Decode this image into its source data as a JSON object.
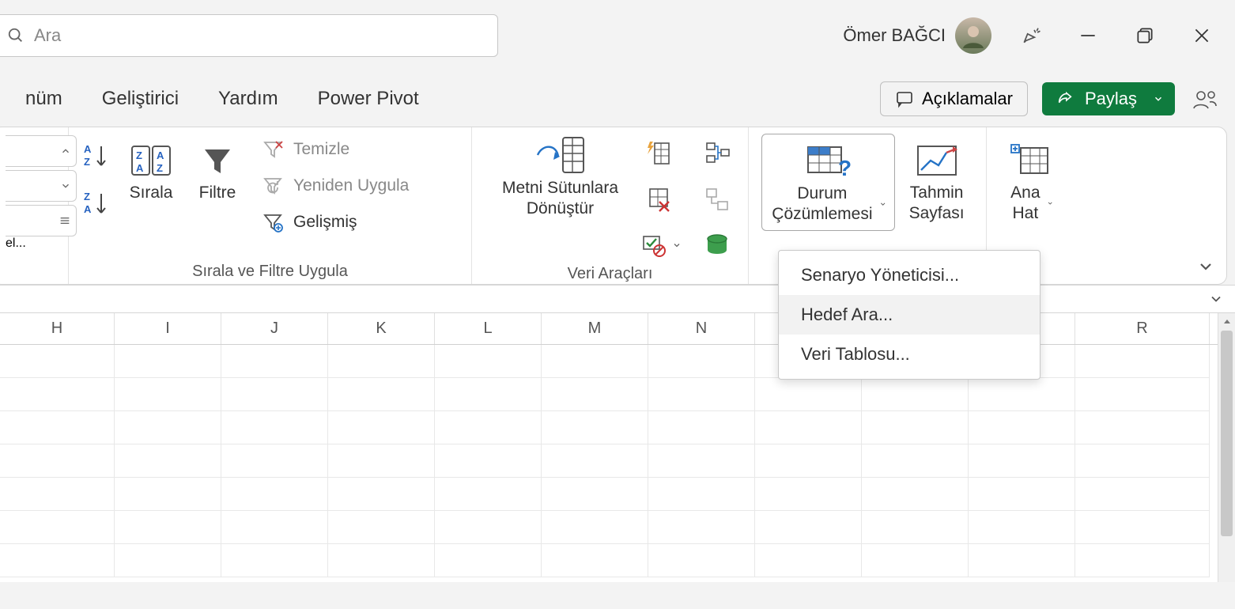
{
  "titlebar": {
    "search_placeholder": "Ara",
    "user_name": "Ömer BAĞCI"
  },
  "tabs": {
    "view": "nüm",
    "developer": "Geliştirici",
    "help": "Yardım",
    "powerpivot": "Power Pivot",
    "comments": "Açıklamalar",
    "share": "Paylaş"
  },
  "ribbon": {
    "queries_label": "el...",
    "sort_filter": {
      "sort": "Sırala",
      "filter": "Filtre",
      "clear": "Temizle",
      "reapply": "Yeniden Uygula",
      "advanced": "Gelişmiş",
      "group_label": "Sırala ve Filtre Uygula"
    },
    "data_tools": {
      "text_to_columns": "Metni Sütunlara Dönüştür",
      "group_label": "Veri Araçları"
    },
    "forecast": {
      "whatif": "Durum Çözümlemesi",
      "forecast_sheet": "Tahmin Sayfası",
      "outline": "Ana Hat"
    }
  },
  "menu": {
    "scenario": "Senaryo Yöneticisi...",
    "goalseek": "Hedef Ara...",
    "datatable": "Veri Tablosu..."
  },
  "columns": [
    "H",
    "I",
    "J",
    "K",
    "L",
    "M",
    "N",
    "",
    "",
    "",
    "R"
  ]
}
